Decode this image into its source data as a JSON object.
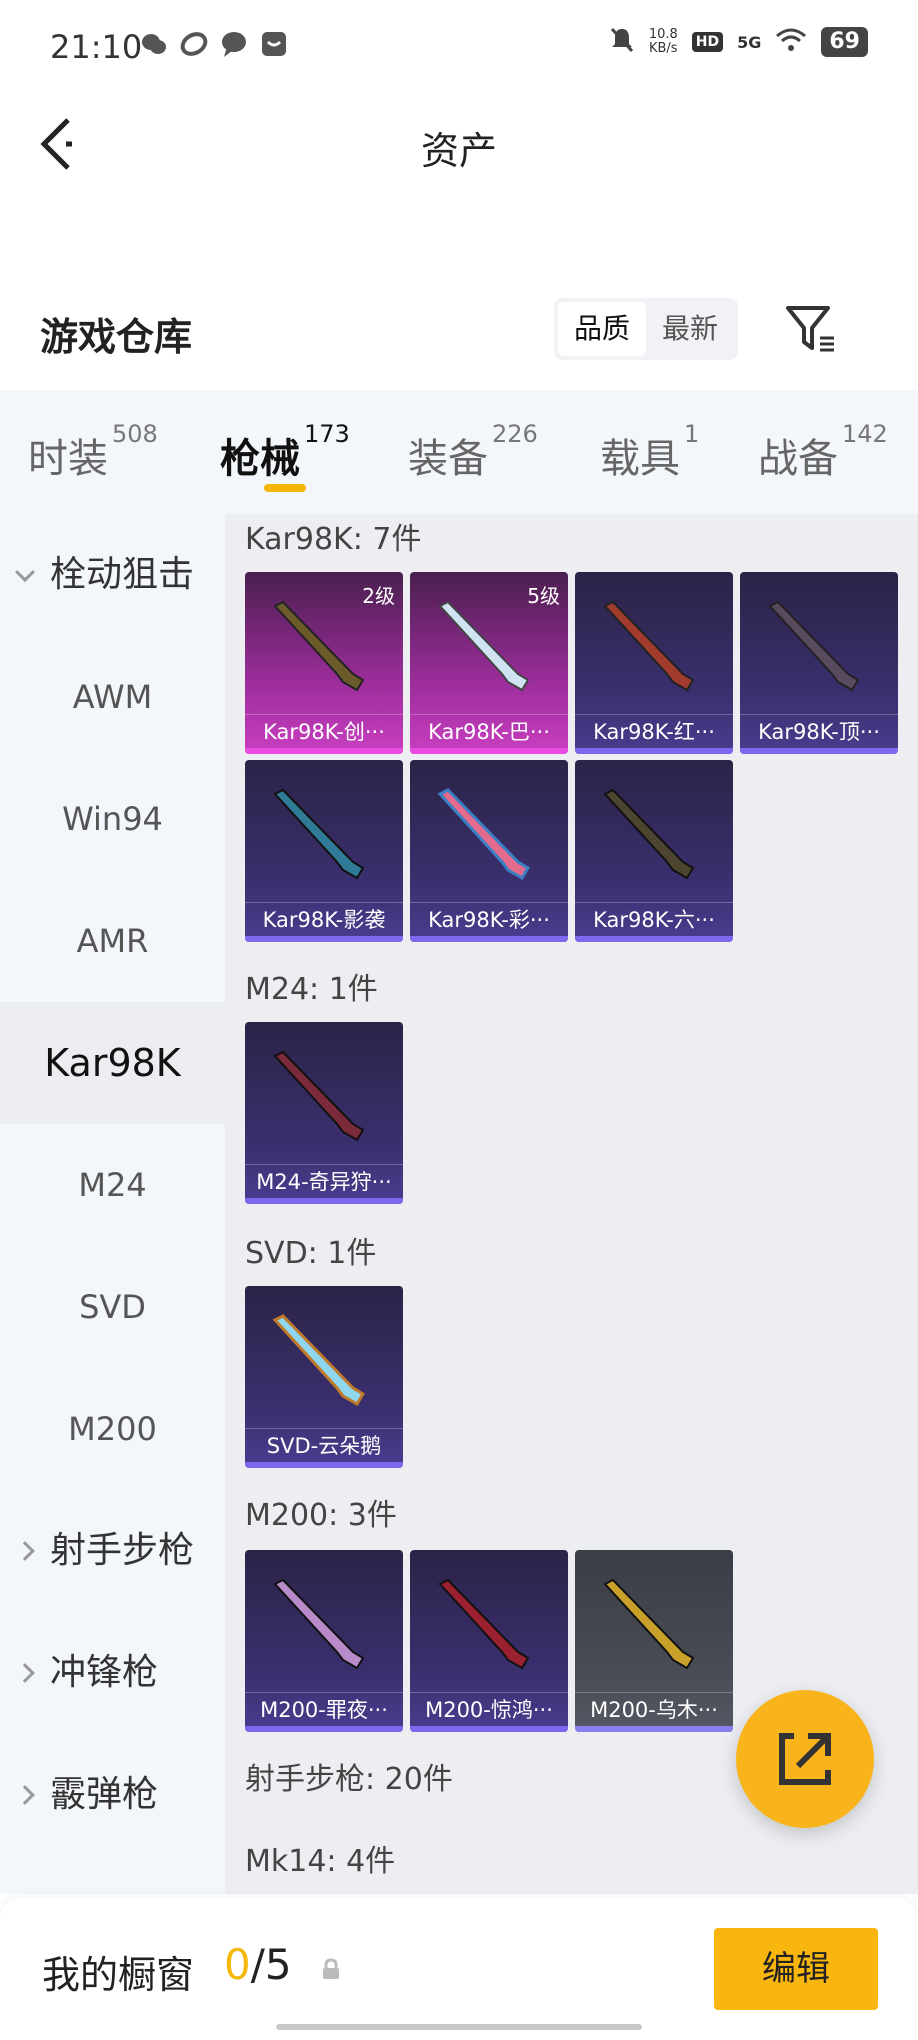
{
  "status_bar": {
    "time": "21:10",
    "net_speed_value": "10.8",
    "net_speed_unit": "KB/s",
    "hd": "HD",
    "network": "5G",
    "battery": "69"
  },
  "nav": {
    "title": "资产"
  },
  "warehouse": {
    "title": "游戏仓库",
    "sort_options": [
      "品质",
      "最新"
    ],
    "active_sort": "品质"
  },
  "tabs": [
    {
      "label": "时装",
      "count": "508"
    },
    {
      "label": "枪械",
      "count": "173"
    },
    {
      "label": "装备",
      "count": "226"
    },
    {
      "label": "载具",
      "count": "1"
    },
    {
      "label": "战备",
      "count": "142"
    }
  ],
  "sidebar": {
    "items": [
      {
        "label": "栓动狙击",
        "type": "group",
        "expanded": true
      },
      {
        "label": "AWM",
        "type": "sub"
      },
      {
        "label": "Win94",
        "type": "sub"
      },
      {
        "label": "AMR",
        "type": "sub"
      },
      {
        "label": "Kar98K",
        "type": "sub",
        "active": true
      },
      {
        "label": "M24",
        "type": "sub"
      },
      {
        "label": "SVD",
        "type": "sub"
      },
      {
        "label": "M200",
        "type": "sub"
      },
      {
        "label": "射手步枪",
        "type": "group"
      },
      {
        "label": "冲锋枪",
        "type": "group"
      },
      {
        "label": "霰弹枪",
        "type": "group"
      }
    ]
  },
  "content": {
    "sections": [
      {
        "title": "Kar98K: 7件",
        "items": [
          {
            "name": "Kar98K-创···",
            "level": "2级",
            "rarity": "pink"
          },
          {
            "name": "Kar98K-巴···",
            "level": "5级",
            "rarity": "pink"
          },
          {
            "name": "Kar98K-红···",
            "level": "",
            "rarity": "purple"
          },
          {
            "name": "Kar98K-顶···",
            "level": "",
            "rarity": "purple"
          },
          {
            "name": "Kar98K-影袭",
            "level": "",
            "rarity": "purple"
          },
          {
            "name": "Kar98K-彩···",
            "level": "",
            "rarity": "purple"
          },
          {
            "name": "Kar98K-六···",
            "level": "",
            "rarity": "purple"
          }
        ]
      },
      {
        "title": "M24: 1件",
        "items": [
          {
            "name": "M24-奇异狩···",
            "level": "",
            "rarity": "purple"
          }
        ]
      },
      {
        "title": "SVD: 1件",
        "items": [
          {
            "name": "SVD-云朵鹅",
            "level": "",
            "rarity": "purple"
          }
        ]
      },
      {
        "title": "M200: 3件",
        "items": [
          {
            "name": "M200-罪夜···",
            "level": "",
            "rarity": "purple"
          },
          {
            "name": "M200-惊鸿···",
            "level": "",
            "rarity": "purple"
          },
          {
            "name": "M200-乌木···",
            "level": "",
            "rarity": "grey"
          }
        ]
      }
    ],
    "group_header": "射手步枪: 20件",
    "next_section_title": "Mk14: 4件"
  },
  "showcase": {
    "label": "我的橱窗",
    "current": "0",
    "separator": "/",
    "max": "5",
    "edit_label": "编辑"
  }
}
